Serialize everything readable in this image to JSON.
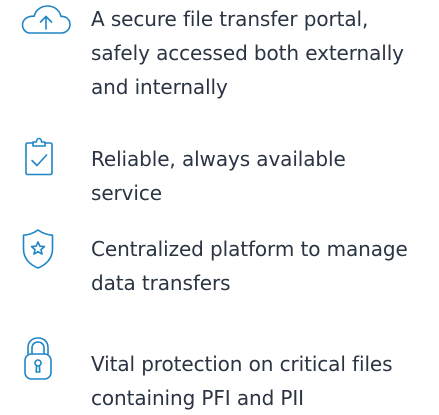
{
  "accent_color": "#1f86c5",
  "text_color": "#2a3443",
  "features": [
    {
      "icon": "cloud-upload-icon",
      "text": "A secure file transfer portal, safely accessed both externally and internally"
    },
    {
      "icon": "clipboard-check-icon",
      "text": "Reliable, always available service"
    },
    {
      "icon": "shield-star-icon",
      "text": "Centralized platform to manage data transfers"
    },
    {
      "icon": "padlock-icon",
      "text": "Vital protection on critical files containing PFI and PII"
    }
  ]
}
